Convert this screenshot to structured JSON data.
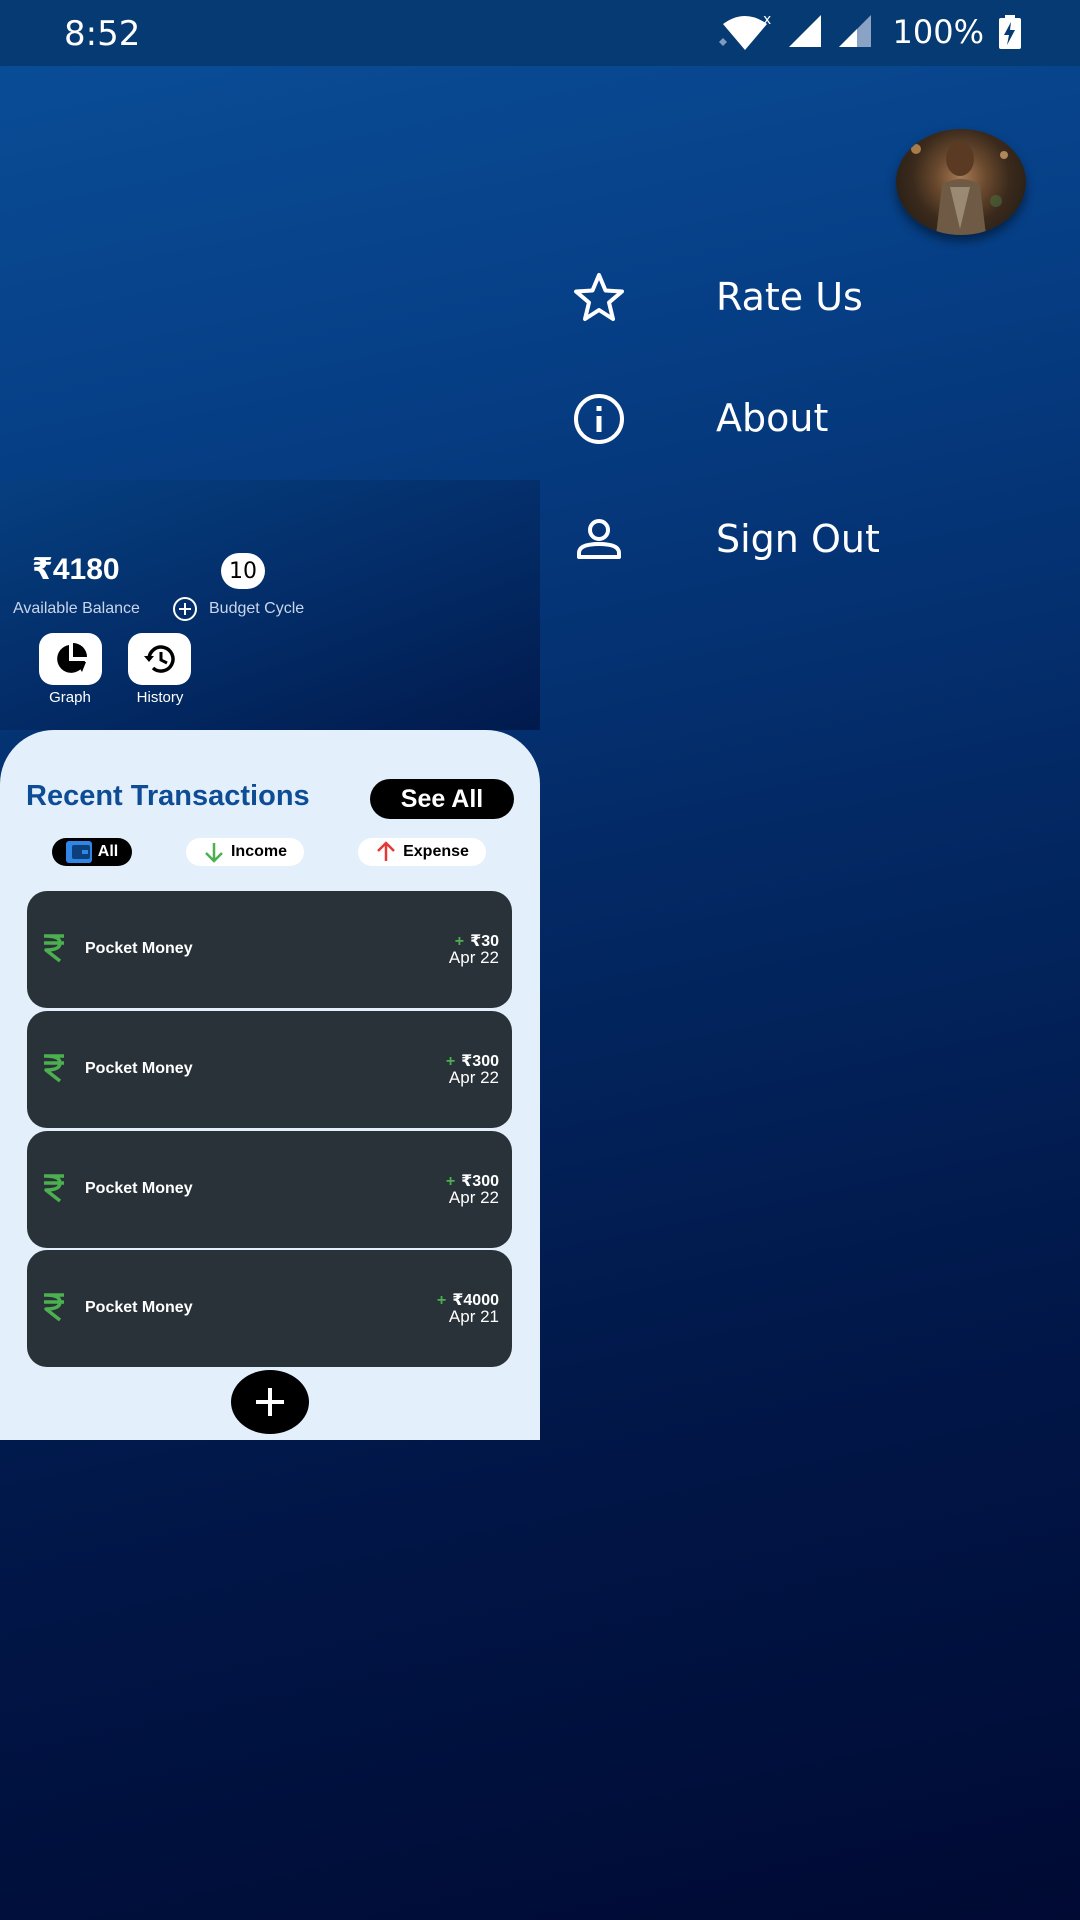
{
  "status_bar": {
    "time": "8:52",
    "battery": "100%"
  },
  "drawer": {
    "menu": [
      {
        "label": "Rate Us",
        "icon": "star-outline-icon"
      },
      {
        "label": "About",
        "icon": "info-outline-icon"
      },
      {
        "label": "Sign Out",
        "icon": "person-outline-icon"
      }
    ]
  },
  "summary": {
    "balance": "₹4180",
    "balance_label": "Available Balance",
    "cycle_value": "10",
    "cycle_label": "Budget Cycle"
  },
  "quick_actions": [
    {
      "label": "Graph",
      "icon": "pie-chart-icon"
    },
    {
      "label": "History",
      "icon": "history-icon"
    }
  ],
  "transactions_section": {
    "title": "Recent Transactions",
    "see_all": "See All",
    "filters": [
      {
        "label": "All",
        "icon": "wallet-icon",
        "active": true
      },
      {
        "label": "Income",
        "icon": "arrow-down-icon",
        "active": false
      },
      {
        "label": "Expense",
        "icon": "arrow-up-icon",
        "active": false
      }
    ],
    "items": [
      {
        "name": "Pocket Money",
        "sign": "+",
        "amount": "₹30",
        "date": "Apr 22"
      },
      {
        "name": "Pocket Money",
        "sign": "+",
        "amount": "₹300",
        "date": "Apr 22"
      },
      {
        "name": "Pocket Money",
        "sign": "+",
        "amount": "₹300",
        "date": "Apr 22"
      },
      {
        "name": "Pocket Money",
        "sign": "+",
        "amount": "₹4000",
        "date": "Apr 21"
      }
    ]
  },
  "colors": {
    "accent_blue": "#0e4d96",
    "income_green": "#4caf50",
    "expense_red": "#e53935",
    "card_dark": "#283238"
  }
}
